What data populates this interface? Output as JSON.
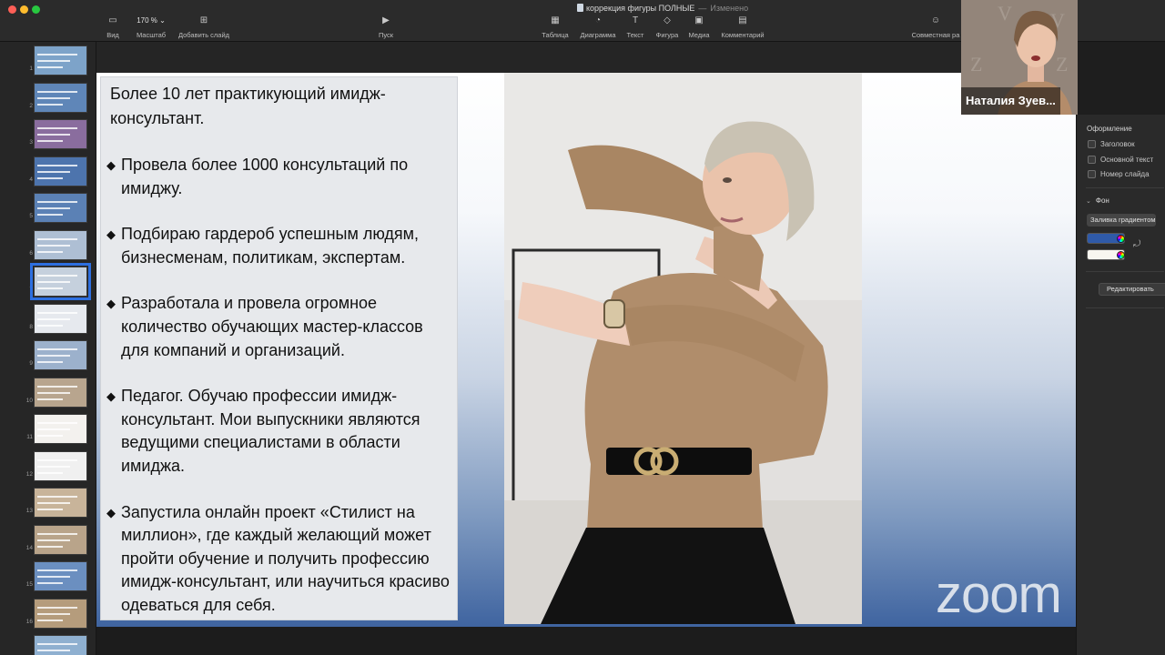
{
  "app": {
    "doc_title": "коррекция фигуры ПОЛНЫЕ",
    "title_separator": "—",
    "status": "Изменено"
  },
  "toolbar": {
    "view": "Вид",
    "zoom_value": "170 %",
    "zoom": "Масштаб",
    "add_slide": "Добавить слайд",
    "play": "Пуск",
    "table": "Таблица",
    "chart": "Диаграмма",
    "text": "Текст",
    "shape": "Фигура",
    "media": "Медиа",
    "comment": "Комментарий",
    "collaborate": "Совместная ра"
  },
  "colors": {
    "selection": "#2d6fe0",
    "toolbar_bg": "#2b2b2b",
    "slide_gradient_bottom": "#3f64a0",
    "slide_gradient_top": "#ffffff"
  },
  "navigator": {
    "slides": [
      {
        "number": "1",
        "bg": "#7da3c9",
        "selected": false
      },
      {
        "number": "2",
        "bg": "#5f86b8",
        "selected": false
      },
      {
        "number": "3",
        "bg": "#8a6d9e",
        "selected": false
      },
      {
        "number": "4",
        "bg": "#4d74ad",
        "selected": false
      },
      {
        "number": "5",
        "bg": "#5b81b5",
        "selected": false
      },
      {
        "number": "6",
        "bg": "#aebfd4",
        "selected": false
      },
      {
        "number": "7",
        "bg": "#c5d0dd",
        "selected": true
      },
      {
        "number": "8",
        "bg": "#e6e9ee",
        "selected": false
      },
      {
        "number": "9",
        "bg": "#9cb1cc",
        "selected": false
      },
      {
        "number": "10",
        "bg": "#b8a58e",
        "selected": false
      },
      {
        "number": "11",
        "bg": "#f3f1ee",
        "selected": false
      },
      {
        "number": "12",
        "bg": "#f0f0f0",
        "selected": false
      },
      {
        "number": "13",
        "bg": "#c8b49a",
        "selected": false
      },
      {
        "number": "14",
        "bg": "#b9a48a",
        "selected": false
      },
      {
        "number": "15",
        "bg": "#6b8fc0",
        "selected": false
      },
      {
        "number": "16",
        "bg": "#b59c7c",
        "selected": false
      },
      {
        "number": "",
        "bg": "#8fb0d0",
        "selected": false
      }
    ]
  },
  "slide": {
    "intro": "Более 10 лет практикующий имидж-консультант.",
    "bullets": [
      "Провела более 1000 консультаций по имиджу.",
      "Подбираю гардероб успешным людям, бизнесменам, политикам, экспертам.",
      "Разработала и провела огромное количество обучающих мастер-классов для компаний и организаций.",
      "Педагог. Обучаю профессии имидж-консультант. Мои выпускники являются ведущими специалистами в области имиджа.",
      "Запустила онлайн проект «Стилист на миллион», где каждый желающий может пройти обучение и получить профессию имидж-консультант, или научиться красиво одеваться для себя."
    ],
    "photo_icon": "portrait-photo"
  },
  "participant": {
    "name": "Наталия Зуев..."
  },
  "inspector": {
    "section_title": "Оформление",
    "options": [
      {
        "label": "Заголовок",
        "checked": false
      },
      {
        "label": "Основной текст",
        "checked": false
      },
      {
        "label": "Номер слайда",
        "checked": false
      }
    ],
    "background_label": "Фон",
    "fill_type": "Заливка градиентом",
    "color1": "#2f5aa8",
    "color2": "#f8f6f0",
    "edit_button": "Редактировать"
  },
  "watermark": "zoom"
}
